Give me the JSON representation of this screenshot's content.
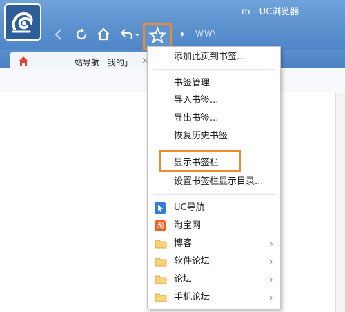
{
  "window": {
    "title": "m - UC浏览器"
  },
  "toolbar": {
    "back_icon": "back-arrow-icon",
    "refresh_icon": "refresh-icon",
    "home_icon": "home-icon",
    "undo_icon": "undo-arrow-icon",
    "bookmark_star_icon": "star-icon",
    "address_text": "WW\\"
  },
  "tab": {
    "title": "站导航 - 我的」",
    "close": "×"
  },
  "bookmark_menu": {
    "add_bookmark": "添加此页到书签...",
    "manage": "书签管理",
    "import": "导入书签...",
    "export": "导出书签...",
    "restore": "恢复历史书签",
    "show_bar": "显示书签栏",
    "set_bar_dir": "设置书签栏显示目录...",
    "items": [
      {
        "label": "UC导航",
        "icon": "uc-nav-icon"
      },
      {
        "label": "淘宝网",
        "icon": "taobao-icon",
        "glyph": "淘"
      },
      {
        "label": "博客",
        "icon": "folder-icon",
        "has_submenu": true
      },
      {
        "label": "软件论坛",
        "icon": "folder-icon",
        "has_submenu": true
      },
      {
        "label": "论坛",
        "icon": "folder-icon",
        "has_submenu": true
      },
      {
        "label": "手机论坛",
        "icon": "folder-icon",
        "has_submenu": true
      }
    ],
    "submenu_arrow": "›"
  },
  "colors": {
    "titlebar": "#5e93cf",
    "highlight": "#ef8a2c",
    "menu_bg": "#ffffff"
  }
}
